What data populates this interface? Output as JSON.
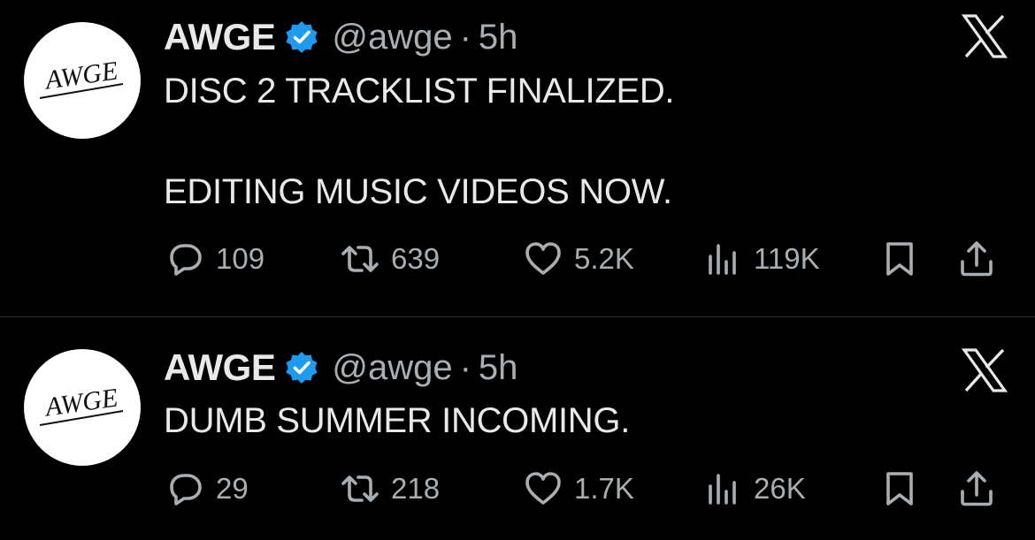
{
  "tweets": [
    {
      "avatar_text": "AWGE",
      "name": "AWGE",
      "handle": "@awge",
      "separator": "·",
      "time": "5h",
      "text": "DISC 2 TRACKLIST FINALIZED.\n\nEDITING MUSIC VIDEOS NOW.",
      "stats": {
        "replies": "109",
        "retweets": "639",
        "likes": "5.2K",
        "views": "119K"
      }
    },
    {
      "avatar_text": "AWGE",
      "name": "AWGE",
      "handle": "@awge",
      "separator": "·",
      "time": "5h",
      "text": "DUMB SUMMER INCOMING.",
      "stats": {
        "replies": "29",
        "retweets": "218",
        "likes": "1.7K",
        "views": "26K"
      }
    }
  ],
  "icons": [
    "verified-badge-icon",
    "x-logo-icon",
    "reply-icon",
    "retweet-icon",
    "like-icon",
    "views-icon",
    "bookmark-icon",
    "share-icon"
  ],
  "colors": {
    "background": "#000000",
    "text": "#e7e9ea",
    "muted": "#a9aeb3",
    "verified": "#1d9bf0",
    "divider": "#2f3336"
  }
}
